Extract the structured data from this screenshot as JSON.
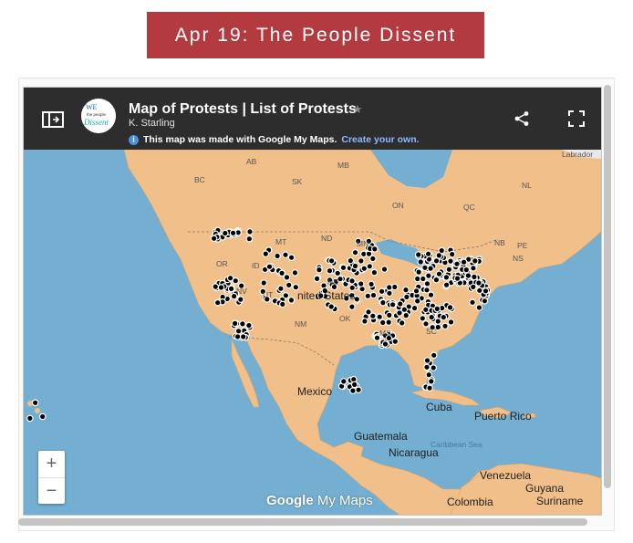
{
  "banner": {
    "title": "Apr 19: The People Dissent"
  },
  "map_header": {
    "title": "Map of Protests | List of Protests",
    "author": "K. Starling",
    "notice_text": "This map was made with Google My Maps.",
    "notice_link": "Create your own.",
    "avatar_top": "WE",
    "avatar_mid": "the people",
    "avatar_bottom": "Dissent"
  },
  "map_labels": {
    "labrador": "Labrador",
    "ab": "AB",
    "mb": "MB",
    "bc": "BC",
    "sk": "SK",
    "on": "ON",
    "qc": "QC",
    "nl": "NL",
    "nb": "NB",
    "pe": "PE",
    "ns": "NS",
    "mt": "MT",
    "nd": "ND",
    "mn": "MN",
    "or": "OR",
    "id": "ID",
    "nv": "NV",
    "ut": "UT",
    "ne": "NE",
    "ok": "OK",
    "nm": "NM",
    "ms": "MS",
    "sc": "SC",
    "united_states": "nited States",
    "mexico": "Mexico",
    "cuba": "Cuba",
    "puerto_rico": "Puerto Rico",
    "guatemala": "Guatemala",
    "nicaragua": "Nicaragua",
    "caribbean_sea": "Caribbean Sea",
    "venezuela": "Venezuela",
    "guyana": "Guyana",
    "suriname": "Suriname",
    "colombia": "Colombia"
  },
  "zoom": {
    "in": "+",
    "out": "−"
  },
  "footer_logo": {
    "google": "Google",
    "mymaps": "My Maps"
  },
  "colors": {
    "banner": "#b33b40",
    "water": "#74aed0",
    "land": "#f2c48e",
    "header": "#2d2d2d"
  }
}
